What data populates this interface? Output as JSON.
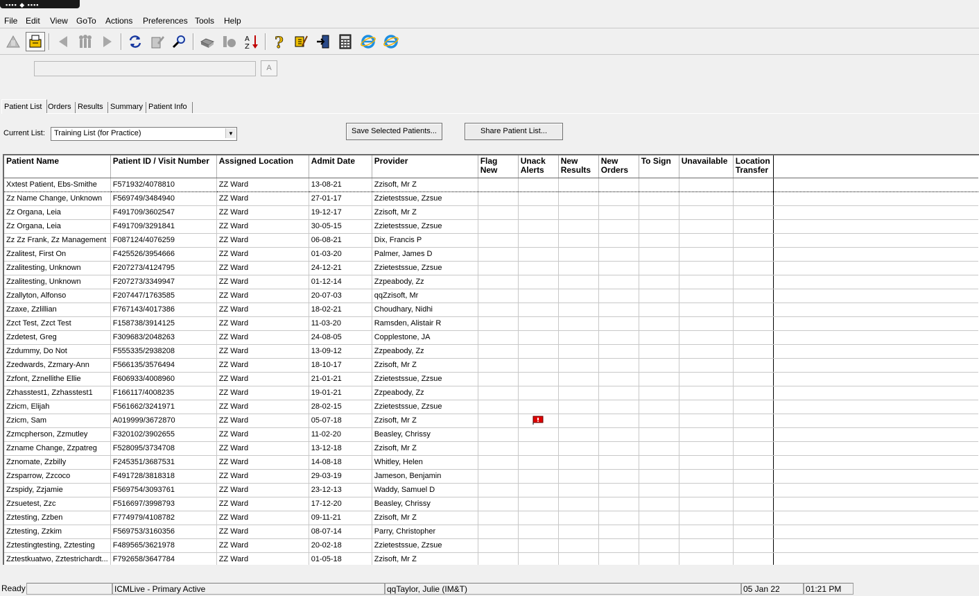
{
  "menu": [
    "File",
    "Edit",
    "View",
    "GoTo",
    "Actions",
    "Preferences",
    "Tools",
    "Help"
  ],
  "toolbar_icons": [
    "patient-list-icon",
    "print-lock-icon",
    "back-arrow-icon",
    "people-icon",
    "forward-arrow-icon",
    "refresh-icon",
    "edit-document-icon",
    "search-icon",
    "printer-icon",
    "tape-icon",
    "sort-az-icon",
    "help-icon",
    "tools-icon",
    "exit-icon",
    "calculator-icon",
    "internet-explorer-icon",
    "internet-explorer-icon-2"
  ],
  "command": {
    "value": "",
    "button": "A"
  },
  "tabs": [
    "Patient List",
    "Orders",
    "Results",
    "Summary",
    "Patient Info"
  ],
  "current_list": {
    "label": "Current List:",
    "value": "Training List (for Practice)"
  },
  "buttons": {
    "save": "Save Selected Patients...",
    "share": "Share Patient List..."
  },
  "columns": [
    "Patient Name",
    "Patient ID / Visit Number",
    "Assigned Location",
    "Admit Date",
    "Provider",
    "Flag New",
    "Unack Alerts",
    "New Results",
    "New Orders",
    "To Sign",
    "Unavailable",
    "Location Transfer"
  ],
  "rows": [
    [
      "Xxtest Patient, Ebs-Smithe",
      "F571932/4078810",
      "ZZ Ward",
      "13-08-21",
      "Zzisoft, Mr Z"
    ],
    [
      "Zz Name Change, Unknown",
      "F569749/3484940",
      "ZZ Ward",
      "27-01-17",
      "Zzietestssue, Zzsue"
    ],
    [
      "Zz Organa, Leia",
      "F491709/3602547",
      "ZZ Ward",
      "19-12-17",
      "Zzisoft, Mr Z"
    ],
    [
      "Zz Organa, Leia",
      "F491709/3291841",
      "ZZ Ward",
      "30-05-15",
      "Zzietestssue, Zzsue"
    ],
    [
      "Zz Zz Frank, Zz Management",
      "F087124/4076259",
      "ZZ Ward",
      "06-08-21",
      "Dix, Francis P"
    ],
    [
      "Zzalitest, First On",
      "F425526/3954666",
      "ZZ Ward",
      "01-03-20",
      "Palmer, James D"
    ],
    [
      "Zzalitesting, Unknown",
      "F207273/4124795",
      "ZZ Ward",
      "24-12-21",
      "Zzietestssue, Zzsue"
    ],
    [
      "Zzalitesting, Unknown",
      "F207273/3349947",
      "ZZ Ward",
      "01-12-14",
      "Zzpeabody, Zz"
    ],
    [
      "Zzallyton, Alfonso",
      "F207447/1763585",
      "ZZ Ward",
      "20-07-03",
      "qqZzisoft, Mr"
    ],
    [
      "Zzaxe, Zzlillian",
      "F767143/4017386",
      "ZZ Ward",
      "18-02-21",
      "Choudhary, Nidhi"
    ],
    [
      "Zzct Test, Zzct Test",
      "F158738/3914125",
      "ZZ Ward",
      "11-03-20",
      "Ramsden, Alistair R"
    ],
    [
      "Zzdetest, Greg",
      "F309683/2048263",
      "ZZ Ward",
      "24-08-05",
      "Copplestone, JA"
    ],
    [
      "Zzdummy, Do Not",
      "F555335/2938208",
      "ZZ Ward",
      "13-09-12",
      "Zzpeabody, Zz"
    ],
    [
      "Zzedwards, Zzmary-Ann",
      "F566135/3576494",
      "ZZ Ward",
      "18-10-17",
      "Zzisoft, Mr Z"
    ],
    [
      "Zzfont, Zznellithe Ellie",
      "F606933/4008960",
      "ZZ Ward",
      "21-01-21",
      "Zzietestssue, Zzsue"
    ],
    [
      "Zzhasstest1, Zzhasstest1",
      "F166117/4008235",
      "ZZ Ward",
      "19-01-21",
      "Zzpeabody, Zz"
    ],
    [
      "Zzicm, Elijah",
      "F561662/3241971",
      "ZZ Ward",
      "28-02-15",
      "Zzietestssue, Zzsue"
    ],
    [
      "Zzicm, Sam",
      "A019999/3672870",
      "ZZ Ward",
      "05-07-18",
      "Zzisoft, Mr Z"
    ],
    [
      "Zzmcpherson, Zzmutley",
      "F320102/3902655",
      "ZZ Ward",
      "11-02-20",
      "Beasley, Chrissy"
    ],
    [
      "Zzname Change, Zzpatreg",
      "F528095/3734708",
      "ZZ Ward",
      "13-12-18",
      "Zzisoft, Mr Z"
    ],
    [
      "Zznomate, Zzbilly",
      "F245351/3687531",
      "ZZ Ward",
      "14-08-18",
      "Whitley, Helen"
    ],
    [
      "Zzsparrow, Zzcoco",
      "F491728/3818318",
      "ZZ Ward",
      "29-03-19",
      "Jameson, Benjamin"
    ],
    [
      "Zzspidy, Zzjamie",
      "F569754/3093761",
      "ZZ Ward",
      "23-12-13",
      "Waddy, Samuel D"
    ],
    [
      "Zzsuetest, Zzc",
      "F516697/3998793",
      "ZZ Ward",
      "17-12-20",
      "Beasley, Chrissy"
    ],
    [
      "Zztesting, Zzben",
      "F774979/4108782",
      "ZZ Ward",
      "09-11-21",
      "Zzisoft, Mr Z"
    ],
    [
      "Zztesting, Zzkim",
      "F569753/3160356",
      "ZZ Ward",
      "08-07-14",
      "Parry, Christopher"
    ],
    [
      "Zztestingtesting, Zztesting",
      "F489565/3621978",
      "ZZ Ward",
      "20-02-18",
      "Zzietestssue, Zzsue"
    ],
    [
      "Zztestkuatwo, Zztestrichardt...",
      "F792658/3647784",
      "ZZ Ward",
      "01-05-18",
      "Zzisoft, Mr Z"
    ]
  ],
  "alert_row_index": 17,
  "colors": {
    "flag": "#e00000",
    "selected_border": "#000000"
  },
  "status": {
    "ready": "Ready",
    "empty": "",
    "system": "ICMLive - Primary Active",
    "user": "qqTaylor, Julie  (IM&T)",
    "date": "05 Jan 22",
    "time": "01:21 PM"
  }
}
